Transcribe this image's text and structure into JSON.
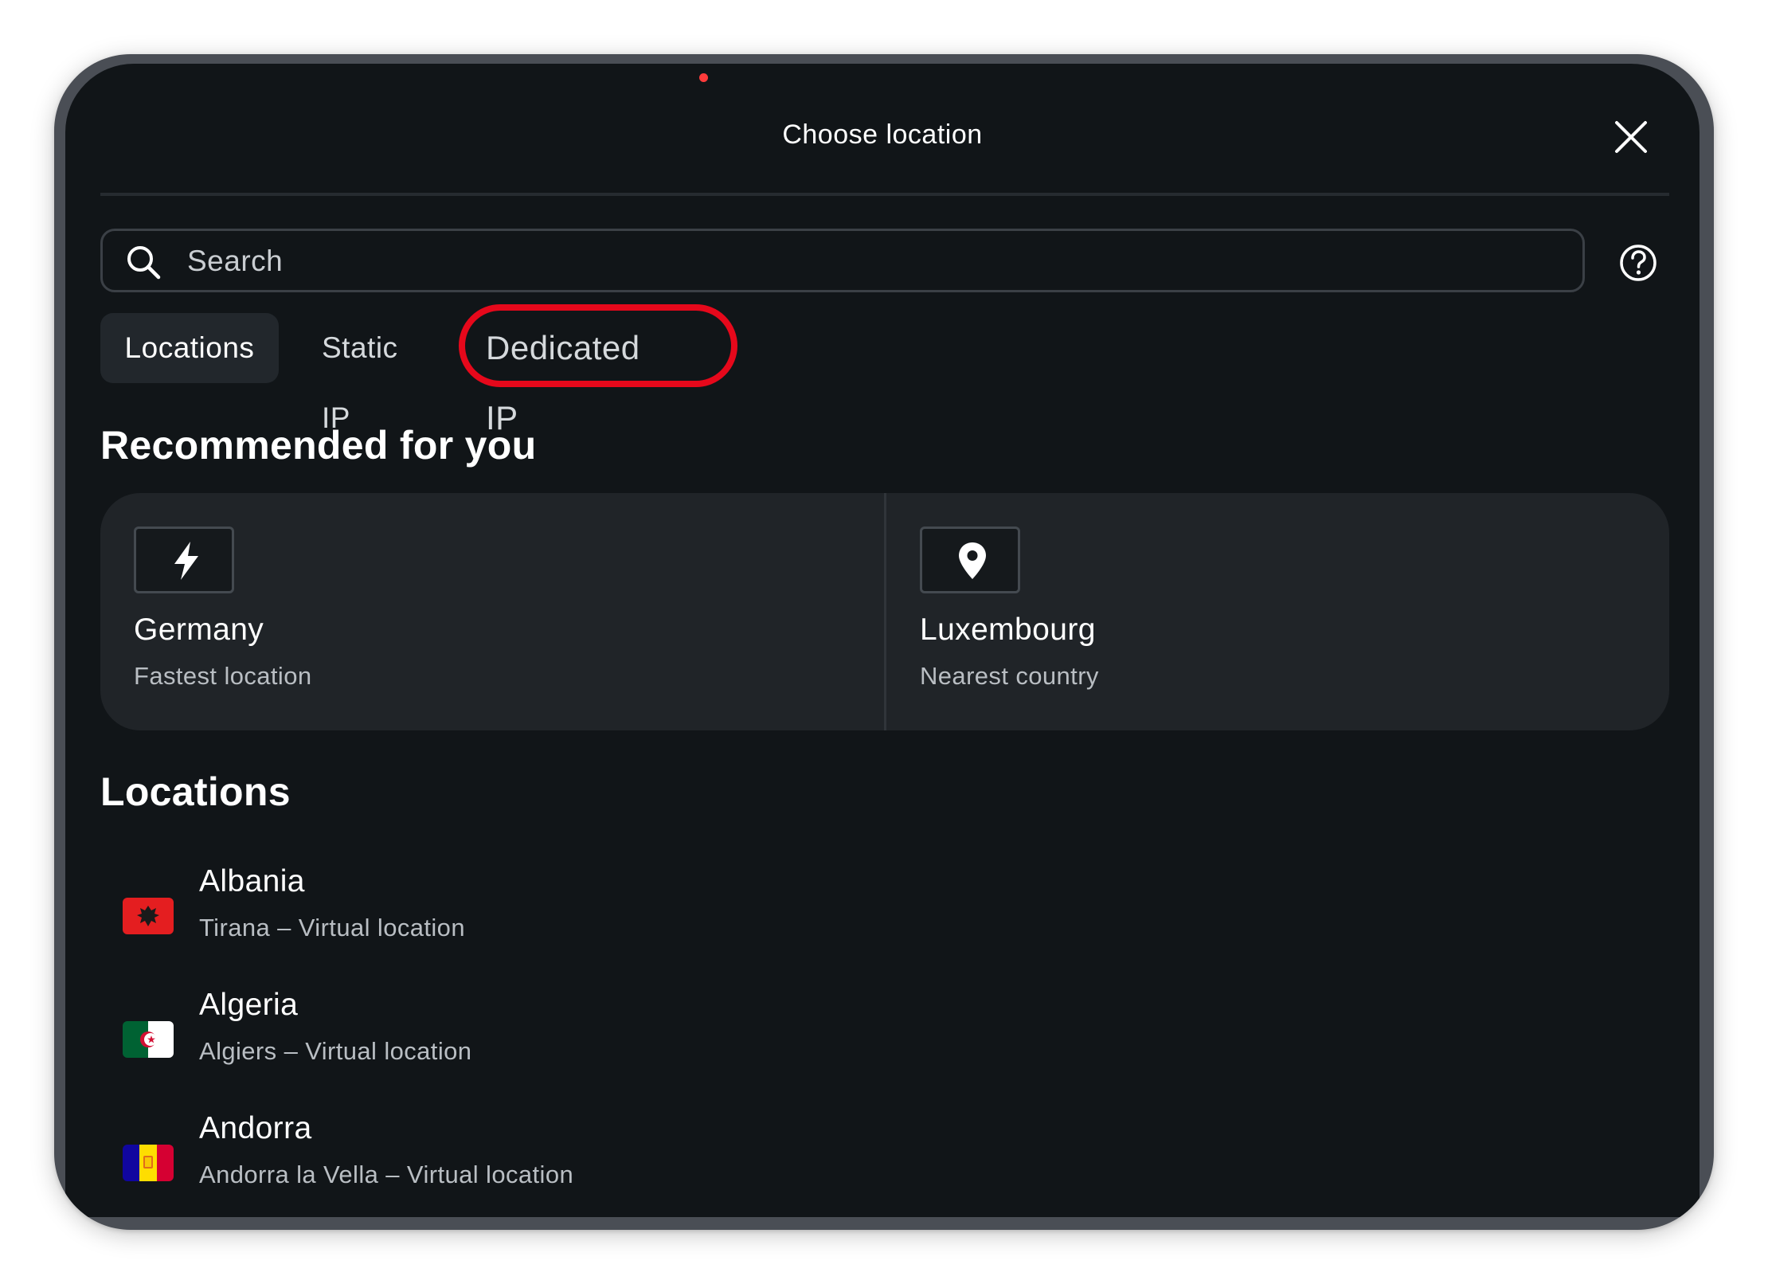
{
  "header": {
    "title": "Choose location"
  },
  "search": {
    "placeholder": "Search",
    "value": ""
  },
  "tabs": [
    {
      "label": "Locations",
      "active": true
    },
    {
      "label": "Static IP",
      "active": false
    },
    {
      "label": "Dedicated IP",
      "active": false,
      "has_notification_dot": true
    }
  ],
  "recommended": {
    "title": "Recommended for you",
    "items": [
      {
        "icon": "lightning-icon",
        "name": "Germany",
        "subtitle": "Fastest location"
      },
      {
        "icon": "map-pin-icon",
        "name": "Luxembourg",
        "subtitle": "Nearest country"
      }
    ]
  },
  "locations": {
    "title": "Locations",
    "items": [
      {
        "flag": "albania-flag-icon",
        "name": "Albania",
        "subtitle": "Tirana – Virtual location"
      },
      {
        "flag": "algeria-flag-icon",
        "name": "Algeria",
        "subtitle": "Algiers – Virtual location"
      },
      {
        "flag": "andorra-flag-icon",
        "name": "Andorra",
        "subtitle": "Andorra la Vella – Virtual location"
      }
    ]
  },
  "colors": {
    "background": "#111518",
    "panel": "#202428",
    "highlight_ring": "#e6081b",
    "notification_dot": "#ff3b3b"
  }
}
